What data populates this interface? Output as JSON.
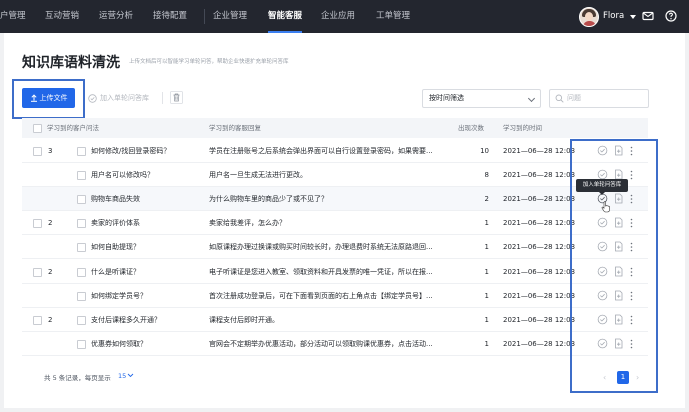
{
  "nav": {
    "items": [
      "户管理",
      "互动营销",
      "运营分析",
      "接待配置",
      "企业管理",
      "智能客服",
      "企业应用",
      "工单管理"
    ],
    "active": "智能客服",
    "user_name": "Flora"
  },
  "page": {
    "title": "知识库语料清洗",
    "subtitle": "上传文档后可以智能学习单轮问答，帮助企业快速扩充单轮问答库"
  },
  "toolbar": {
    "upload_label": "上传文件",
    "add_faq_label": "加入单轮问答库",
    "time_filter_label": "按时间筛选",
    "search_placeholder": "问题"
  },
  "table": {
    "headers": {
      "question": "学习到的客户问法",
      "answer": "学习到的客服回复",
      "count": "出现次数",
      "time": "学习到的时间"
    },
    "rows": [
      {
        "group": "3",
        "question": "如何修改/找回登录密码？",
        "answer": "学员在注册账号之后系统会弹出界面可以自行设置登录密码，如果需要...",
        "count": "10",
        "time": "2021—06—28 12:03"
      },
      {
        "group": "",
        "question": "用户名可以修改吗？",
        "answer": "用户名一旦生成无法进行更改。",
        "count": "8",
        "time": "2021—06—28 12:03"
      },
      {
        "group": "",
        "question": "购物车商品失效",
        "answer": "为什么购物车里的商品少了或不见了？",
        "count": "2",
        "time": "2021—06—28 12:03"
      },
      {
        "group": "2",
        "question": "卖家的评价体系",
        "answer": "卖家给我差评，怎么办？",
        "count": "1",
        "time": "2021—06—28 12:03"
      },
      {
        "group": "",
        "question": "如何自助提现？",
        "answer": "如原课程办理过换课或购买时间较长时，办理退费时系统无法原路退回...",
        "count": "1",
        "time": "2021—06—28 12:03"
      },
      {
        "group": "2",
        "question": "什么是听课证？",
        "answer": "电子听课证是您进入教室、领取资料和开具发票的唯一凭证，所以在报...",
        "count": "1",
        "time": "2021—06—28 12:03"
      },
      {
        "group": "",
        "question": "如何绑定学员号？",
        "answer": "首次注册成功登录后，可在下面看到页面的右上角点击【绑定学员号】...",
        "count": "1",
        "time": "2021—06—28 12:03"
      },
      {
        "group": "2",
        "question": "支付后课程多久开通？",
        "answer": "课程支付后即时开通。",
        "count": "1",
        "time": "2021—06—28 12:03"
      },
      {
        "group": "",
        "question": "优惠券如何领取？",
        "answer": "官网会不定期举办优惠活动，部分活动可以领取购课优惠券，点击活动...",
        "count": "1",
        "time": "2021—06—28 12:03"
      }
    ],
    "tooltip": "加入单轮问答库"
  },
  "footer": {
    "summary": "共 5 条记录，每页显示",
    "page_size": "15",
    "current_page": "1",
    "prev": "‹",
    "next": "›"
  },
  "colors": {
    "nav_bg": "#23262f",
    "primary": "#2167e8",
    "highlight_box": "#3d6dc9"
  }
}
